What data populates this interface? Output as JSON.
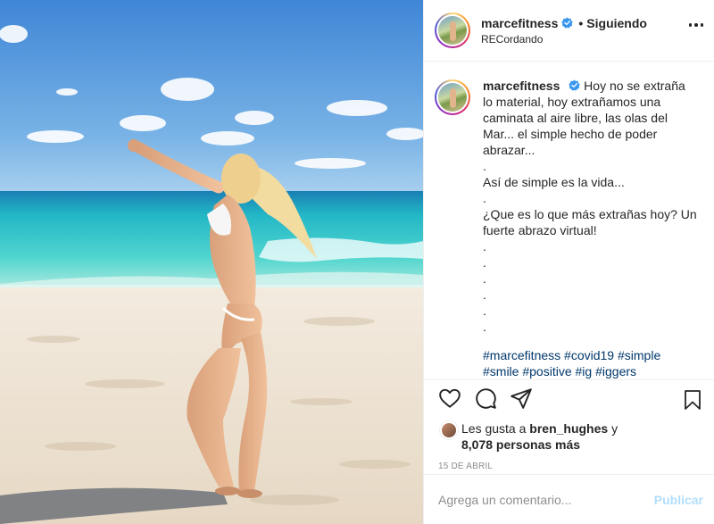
{
  "post": {
    "author": {
      "username": "marcefitness",
      "verified": true,
      "follow_status": "Siguiendo",
      "location": "RECordando"
    },
    "image": {
      "description_colors": {
        "sky": "#4f93d8",
        "sea": "#3cc4c4",
        "sand": "#efe4d4"
      }
    },
    "caption": {
      "username": "marcefitness",
      "lines": [
        "Hoy no se extraña lo material, hoy extrañamos una caminata al aire libre, las olas del Mar... el simple hecho de poder abrazar...",
        ".",
        "Así de simple es la vida...",
        ".",
        "¿Que es lo que más extrañas hoy? Un fuerte abrazo virtual!",
        ".",
        ".",
        ".",
        ".",
        ".",
        "."
      ],
      "hashtags": [
        "#marcefitness",
        "#covid19",
        "#simple",
        "#smile",
        "#positive",
        "#ig",
        "#iggers"
      ]
    },
    "actions": {
      "like_icon": "heart-icon",
      "comment_icon": "comment-icon",
      "share_icon": "share-icon",
      "save_icon": "bookmark-icon"
    },
    "likes": {
      "prefix": "Les gusta a",
      "user": "bren_hughes",
      "connector": "y",
      "others": "8,078 personas más"
    },
    "date": "15 DE ABRIL",
    "comment_box": {
      "placeholder": "Agrega un comentario...",
      "submit_label": "Publicar"
    }
  },
  "colors": {
    "verified_blue": "#3897f0",
    "link_blue": "#00376b",
    "publish_disabled": "#b2dffc"
  }
}
